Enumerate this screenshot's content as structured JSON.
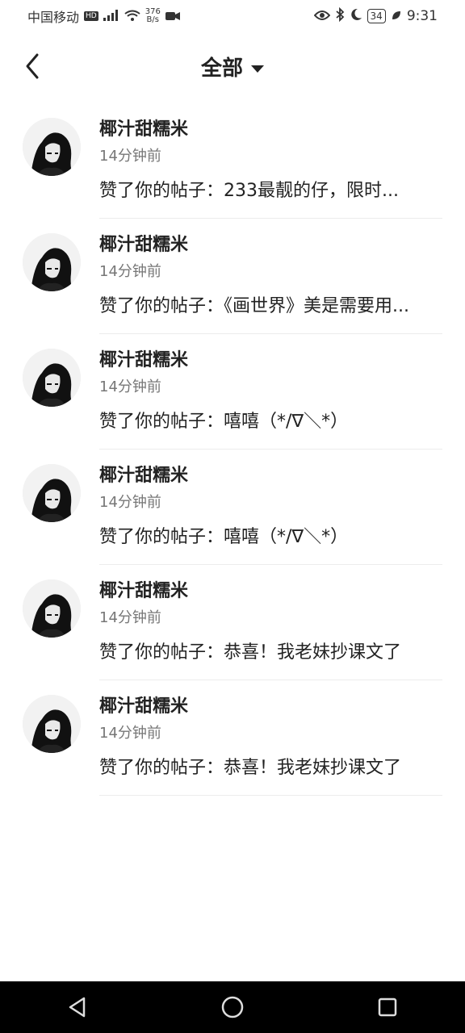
{
  "status_bar": {
    "carrier": "中国移动",
    "hd": "HD",
    "net_rate_value": "376",
    "net_rate_unit": "B/s",
    "battery": "34",
    "time": "9:31"
  },
  "header": {
    "title": "全部"
  },
  "notifications": [
    {
      "name": "椰汁甜糯米",
      "time": "14分钟前",
      "message": "赞了你的帖子：233最靓的仔，限时..."
    },
    {
      "name": "椰汁甜糯米",
      "time": "14分钟前",
      "message": "赞了你的帖子：《画世界》美是需要用..."
    },
    {
      "name": "椰汁甜糯米",
      "time": "14分钟前",
      "message": "赞了你的帖子：嘻嘻（*/∇＼*）"
    },
    {
      "name": "椰汁甜糯米",
      "time": "14分钟前",
      "message": "赞了你的帖子：嘻嘻（*/∇＼*）"
    },
    {
      "name": "椰汁甜糯米",
      "time": "14分钟前",
      "message": "赞了你的帖子：恭喜！我老妹抄课文了"
    },
    {
      "name": "椰汁甜糯米",
      "time": "14分钟前",
      "message": "赞了你的帖子：恭喜！我老妹抄课文了"
    }
  ],
  "icons": {
    "back": "back-arrow-icon",
    "dropdown": "caret-down-icon",
    "nav_back": "triangle-back-icon",
    "nav_home": "circle-home-icon",
    "nav_recent": "square-recent-icon"
  }
}
